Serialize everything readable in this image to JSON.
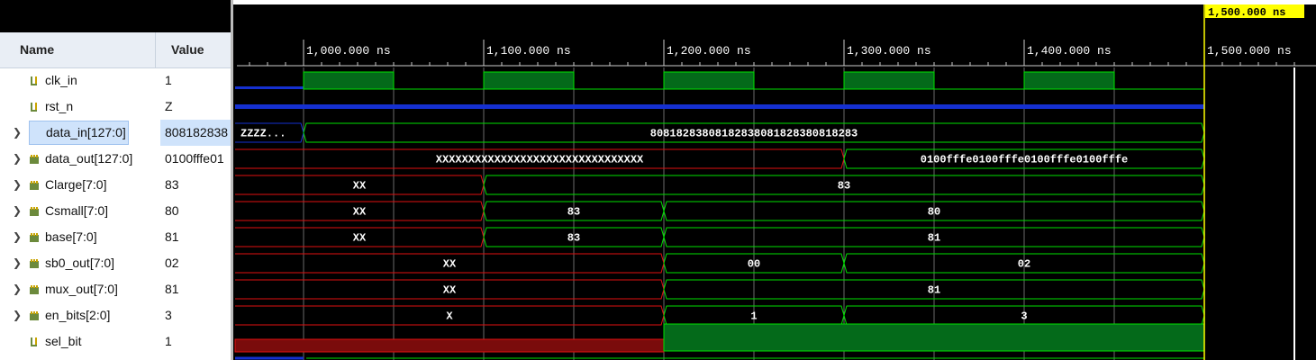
{
  "columns": {
    "name": "Name",
    "value": "Value"
  },
  "cursor_label": "1,500.000 ns",
  "time_labels": [
    "1,000.000 ns",
    "1,100.000 ns",
    "1,200.000 ns",
    "1,300.000 ns",
    "1,400.000 ns",
    "1,500.000 ns"
  ],
  "signals": [
    {
      "name": "clk_in",
      "value": "1",
      "icon": "bit-signal-icon",
      "expandable": false
    },
    {
      "name": "rst_n",
      "value": "Z",
      "icon": "bit-signal-icon",
      "expandable": false
    },
    {
      "name": "data_in[127:0]",
      "value": "808182838",
      "icon": "bus-signal-icon",
      "expandable": true,
      "selected": true
    },
    {
      "name": "data_out[127:0]",
      "value": "0100fffe01",
      "icon": "bus-signal-icon",
      "expandable": true
    },
    {
      "name": "Clarge[7:0]",
      "value": "83",
      "icon": "bus-signal-icon",
      "expandable": true
    },
    {
      "name": "Csmall[7:0]",
      "value": "80",
      "icon": "bus-signal-icon",
      "expandable": true
    },
    {
      "name": "base[7:0]",
      "value": "81",
      "icon": "bus-signal-icon",
      "expandable": true
    },
    {
      "name": "sb0_out[7:0]",
      "value": "02",
      "icon": "bus-signal-icon",
      "expandable": true
    },
    {
      "name": "mux_out[7:0]",
      "value": "81",
      "icon": "bus-signal-icon",
      "expandable": true
    },
    {
      "name": "en_bits[2:0]",
      "value": "3",
      "icon": "bus-signal-icon",
      "expandable": true
    },
    {
      "name": "sel_bit",
      "value": "1",
      "icon": "bit-signal-icon",
      "expandable": false
    }
  ],
  "waveforms": {
    "time_start_ns": 962,
    "time_end_ns": 1562,
    "clk_high_intervals_ns": [
      [
        1000,
        1050
      ],
      [
        1100,
        1150
      ],
      [
        1200,
        1250
      ],
      [
        1300,
        1350
      ],
      [
        1400,
        1450
      ]
    ],
    "bus_segments": [
      [
        {
          "t0": 962,
          "t1": 1000,
          "label": "ZZZZ...",
          "state": "z"
        },
        {
          "t0": 1000,
          "t1": 1500,
          "label": "80818283808182838081828380818283",
          "state": "valid"
        }
      ],
      [
        {
          "t0": 962,
          "t1": 1300,
          "label": "XXXXXXXXXXXXXXXXXXXXXXXXXXXXXXXX",
          "state": "x"
        },
        {
          "t0": 1300,
          "t1": 1500,
          "label": "0100fffe0100fffe0100fffe0100fffe",
          "state": "valid"
        }
      ],
      [
        {
          "t0": 962,
          "t1": 1100,
          "label": "XX",
          "state": "x"
        },
        {
          "t0": 1100,
          "t1": 1500,
          "label": "83",
          "state": "valid"
        }
      ],
      [
        {
          "t0": 962,
          "t1": 1100,
          "label": "XX",
          "state": "x"
        },
        {
          "t0": 1100,
          "t1": 1200,
          "label": "83",
          "state": "valid"
        },
        {
          "t0": 1200,
          "t1": 1500,
          "label": "80",
          "state": "valid"
        }
      ],
      [
        {
          "t0": 962,
          "t1": 1100,
          "label": "XX",
          "state": "x"
        },
        {
          "t0": 1100,
          "t1": 1200,
          "label": "83",
          "state": "valid"
        },
        {
          "t0": 1200,
          "t1": 1500,
          "label": "81",
          "state": "valid"
        }
      ],
      [
        {
          "t0": 962,
          "t1": 1200,
          "label": "XX",
          "state": "x"
        },
        {
          "t0": 1200,
          "t1": 1300,
          "label": "00",
          "state": "valid"
        },
        {
          "t0": 1300,
          "t1": 1500,
          "label": "02",
          "state": "valid"
        }
      ],
      [
        {
          "t0": 962,
          "t1": 1200,
          "label": "XX",
          "state": "x"
        },
        {
          "t0": 1200,
          "t1": 1500,
          "label": "81",
          "state": "valid"
        }
      ],
      [
        {
          "t0": 962,
          "t1": 1200,
          "label": "X",
          "state": "x"
        },
        {
          "t0": 1200,
          "t1": 1300,
          "label": "1",
          "state": "valid"
        },
        {
          "t0": 1300,
          "t1": 1500,
          "label": "3",
          "state": "valid"
        }
      ]
    ],
    "sel_bit": [
      {
        "t0": 962,
        "t1": 1200,
        "state": "x"
      },
      {
        "t0": 1200,
        "t1": 1500,
        "state": "high"
      }
    ]
  },
  "colors": {
    "valid": "#00e000",
    "x": "#e01010",
    "z": "#1530d0",
    "cursor": "#ffff00",
    "grid": "#6a6a6a"
  }
}
